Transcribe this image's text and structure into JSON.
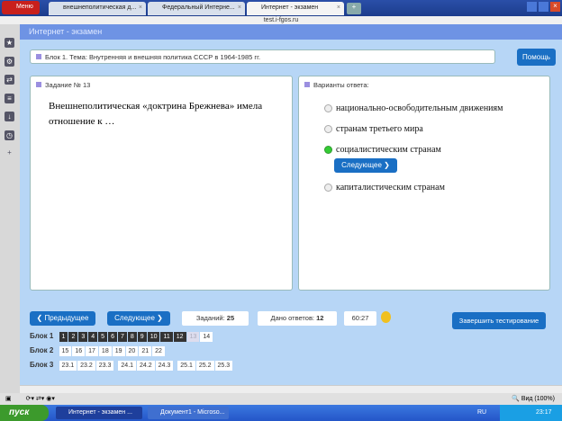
{
  "browser": {
    "menu": "Меню",
    "tabs": [
      "внешнеполитическая д...",
      "Федеральный Интерне...",
      "Интернет - экзамен"
    ],
    "address": "test.i-fgos.ru",
    "zoom": "Вид (100%)"
  },
  "header": {
    "title": "Интернет - экзамен"
  },
  "topic": "Блок 1. Тема: Внутренняя и внешняя политика СССР в 1964-1985 гг.",
  "help_button": "Помощь",
  "task": {
    "label": "Задание № 13",
    "question": "Внешнеполитическая «доктрина Брежнева» имела отношение к …"
  },
  "answers": {
    "label": "Варианты ответа:",
    "options": [
      {
        "text": "национально-освободительным движениям",
        "selected": false
      },
      {
        "text": "странам третьего мира",
        "selected": false
      },
      {
        "text": "социалистическим странам",
        "selected": true
      },
      {
        "text": "капиталистическим странам",
        "selected": false
      }
    ],
    "next_inline": "Следующее"
  },
  "nav": {
    "prev": "Предыдущее",
    "next": "Следующее",
    "tasks_label": "Заданий:",
    "tasks": "25",
    "answered_label": "Дано ответов:",
    "answered": "12",
    "timer": "60:27",
    "finish": "Завершить тестирование"
  },
  "blocks": [
    {
      "label": "Блок 1",
      "items": [
        "1",
        "2",
        "3",
        "4",
        "5",
        "6",
        "7",
        "8",
        "9",
        "10",
        "11",
        "12",
        "13",
        "14"
      ],
      "done": 12,
      "current": "13"
    },
    {
      "label": "Блок 2",
      "items": [
        "15",
        "16",
        "17",
        "18",
        "19",
        "20",
        "21",
        "22"
      ],
      "done": 0
    },
    {
      "label": "Блок 3",
      "items": [
        "23.1",
        "23.2",
        "23.3",
        "24.1",
        "24.2",
        "24.3",
        "25.1",
        "25.2",
        "25.3"
      ],
      "done": 0
    }
  ],
  "taskbar": {
    "start": "пуск",
    "items": [
      "Интернет - экзамен ...",
      "Документ1 - Microso..."
    ],
    "lang": "RU",
    "time": "23:17"
  }
}
